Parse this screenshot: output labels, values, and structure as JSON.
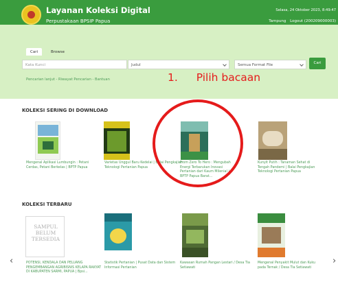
{
  "header": {
    "title": "Layanan Koleksi Digital",
    "subtitle": "Perpustakaan BPSIP Papua",
    "datetime": "Selasa, 24 Oktober 2023, 8:49:47",
    "nav": [
      "Tampung",
      "Logout (200209000003)"
    ]
  },
  "search": {
    "tabs": [
      "Cari",
      "Browse"
    ],
    "keyword_placeholder": "Kata Kunci",
    "field_select": "Judul",
    "format_select": "Semua Format File",
    "button": "Cari",
    "links": "Pencarian lanjut - Riwayat Pencarian - Bantuan"
  },
  "annotation": {
    "number": "1.",
    "text": "Pilih bacaan"
  },
  "sections": {
    "popular": {
      "title": "KOLEKSI SERING DI DOWNLOAD",
      "items": [
        "Mengenal Aplikasi Lumbungin : Petani Cerdas, Petani Berkelas | BPTP Papua",
        "Varietas Unggul Baru Kedelai | Balai Pengkajian Teknologi Pertanian Papua",
        "From Zero To Hero : Mengubah Energi Terbarukan Inovasi Pertanian dari Kaum Milenial | BPTP Papua Barat...",
        "Kunyit Putih : Tanaman Sehat di Tengah Pandemi | Balai Pengkajian Teknologi Pertanian Papua"
      ]
    },
    "latest": {
      "title": "KOLEKSI TERBARU",
      "items": [
        "POTENSI, KENDALA DAN PELUANG PENGEMBANGAN AGRIBISNIS KELAPA RAKYAT DI KABUPATEN SARMI, PAPUA | Bpsi...",
        "Statistik Pertanian | Pusat Data dan Sistem Informasi Pertanian",
        "Kawasan Rumah Pangan Lestari / Desa Tia Setiawati",
        "Mengenal Penyakit Mulut dan Kuku pada Ternak / Desa Tia Setiawati"
      ]
    }
  },
  "placeholder_cover": "SAMPUL BELUM TERSEDIA",
  "nav_arrows": {
    "left": "‹",
    "right": "›"
  },
  "colors": {
    "header": "#3a9c3e",
    "panel": "#d7f0c4",
    "link": "#4c9b57",
    "annotation": "#e51b1b"
  }
}
